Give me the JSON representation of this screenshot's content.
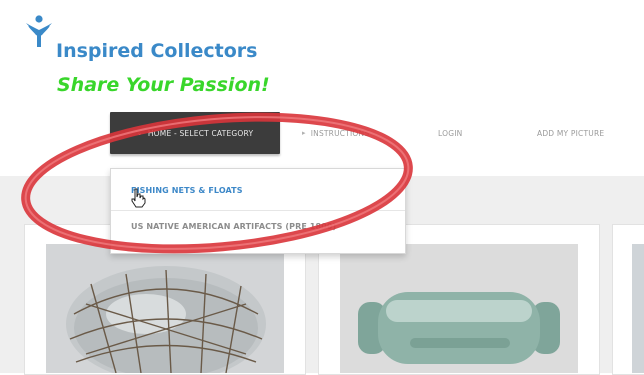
{
  "brand": {
    "name": "Inspired Collectors",
    "tagline": "Share Your Passion!",
    "logo_icon": "figure-y-icon",
    "colors": {
      "name": "#3a89c8",
      "tagline": "#39d62b",
      "nav_selected_bg": "#3c3c3c",
      "annotation": "#d9343a"
    }
  },
  "nav": {
    "selected": "HOME - SELECT CATEGORY",
    "items": [
      {
        "label": "INSTRUCTIONS"
      },
      {
        "label": "LOGIN"
      },
      {
        "label": "ADD MY PICTURE"
      }
    ]
  },
  "dropdown": {
    "items": [
      {
        "label": "FISHING NETS & FLOATS"
      },
      {
        "label": "US NATIVE AMERICAN ARTIFACTS (PRE 1800)"
      }
    ]
  },
  "cards": [
    {
      "image": "netted-glass-float-photo"
    },
    {
      "image": "glass-rolling-pin-float-photo"
    },
    {
      "image": "partial-photo"
    }
  ]
}
